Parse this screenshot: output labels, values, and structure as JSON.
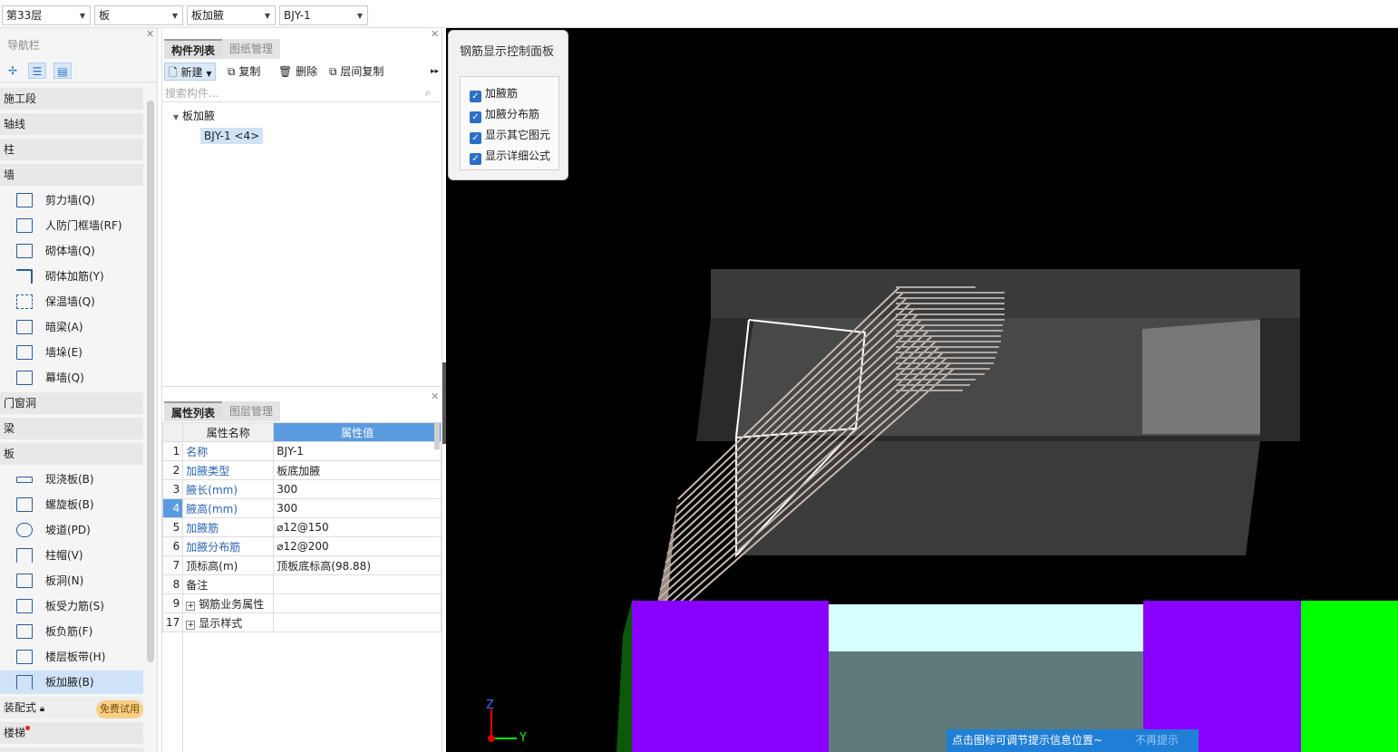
{
  "topbar": {
    "floor": "第33层",
    "category": "板",
    "type": "板加腋",
    "component": "BJY-1"
  },
  "nav": {
    "title": "导航栏",
    "categories": {
      "c1": "施工段",
      "c2": "轴线",
      "c3": "柱",
      "c4": "墙",
      "c5": "门窗洞",
      "c6": "梁",
      "c7": "板",
      "c8": "装配式",
      "c9": "楼梯"
    },
    "wall_items": [
      "剪力墙(Q)",
      "人防门框墙(RF)",
      "砌体墙(Q)",
      "砌体加筋(Y)",
      "保温墙(Q)",
      "暗梁(A)",
      "墙垛(E)",
      "幕墙(Q)"
    ],
    "slab_items": [
      "现浇板(B)",
      "螺旋板(B)",
      "坡道(PD)",
      "柱帽(V)",
      "板洞(N)",
      "板受力筋(S)",
      "板负筋(F)",
      "楼层板带(H)",
      "板加腋(B)"
    ],
    "trial_badge": "免费试用"
  },
  "component_panel": {
    "tab_active": "构件列表",
    "tab_other": "图纸管理",
    "toolbar": {
      "new": "新建",
      "copy": "复制",
      "delete": "删除",
      "floor_copy": "层间复制"
    },
    "search_placeholder": "搜索构件...",
    "tree_root": "板加腋",
    "tree_item": "BJY-1  <4>"
  },
  "property_panel": {
    "tab_active": "属性列表",
    "tab_other": "图层管理",
    "col_name": "属性名称",
    "col_value": "属性值",
    "rows": [
      {
        "num": "1",
        "name": "名称",
        "value": "BJY-1"
      },
      {
        "num": "2",
        "name": "加腋类型",
        "value": "板底加腋"
      },
      {
        "num": "3",
        "name": "腋长(mm)",
        "value": "300"
      },
      {
        "num": "4",
        "name": "腋高(mm)",
        "value": "300"
      },
      {
        "num": "5",
        "name": "加腋筋",
        "value": "⌀12@150"
      },
      {
        "num": "6",
        "name": "加腋分布筋",
        "value": "⌀12@200"
      },
      {
        "num": "7",
        "name": "顶标高(m)",
        "value": "顶板底标高(98.88)"
      },
      {
        "num": "8",
        "name": "备注",
        "value": ""
      },
      {
        "num": "9",
        "name": "钢筋业务属性",
        "value": ""
      },
      {
        "num": "17",
        "name": "显示样式",
        "value": ""
      }
    ]
  },
  "control_panel": {
    "title": "钢筋显示控制面板",
    "options": [
      "加腋筋",
      "加腋分布筋",
      "显示其它图元",
      "显示详细公式"
    ]
  },
  "viewport": {
    "axis_z": "Z",
    "axis_y": "Y",
    "tip": "点击图标可调节提示信息位置~",
    "tip_dismiss": "不再提示"
  },
  "colors": {
    "accent": "#5a9be0",
    "purple": "#8a00ff",
    "green": "#00ff00",
    "cyan": "#d6ffff"
  }
}
